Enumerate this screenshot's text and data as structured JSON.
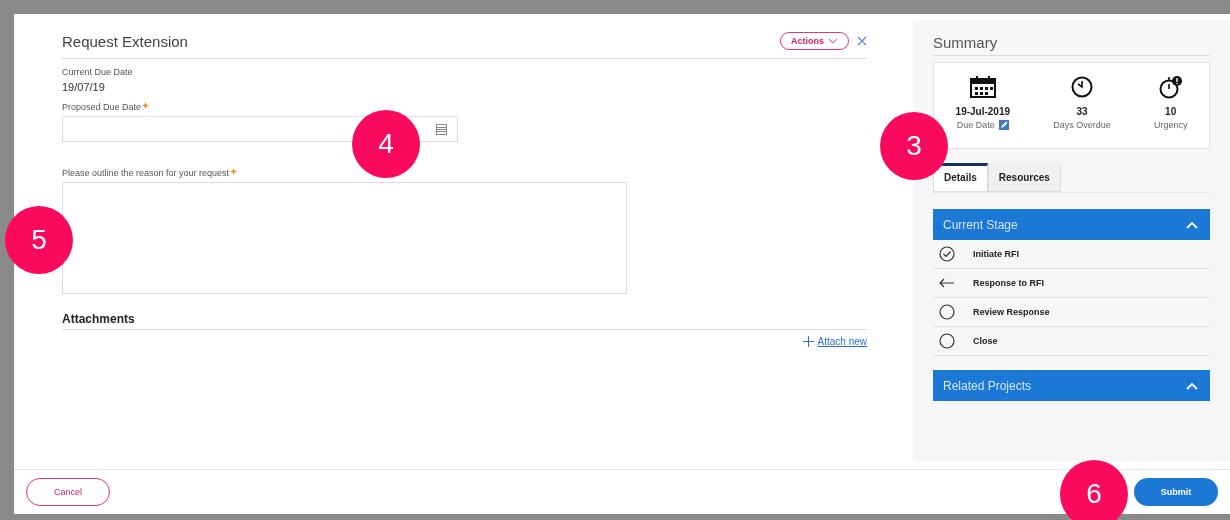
{
  "dialog": {
    "title": "Request Extension",
    "actions_button": "Actions",
    "current_due_date": {
      "label": "Current Due Date",
      "value": "19/07/19"
    },
    "proposed_due_date": {
      "label": "Proposed Due Date",
      "required": true
    },
    "reason": {
      "label": "Please outline the reason for your request",
      "required": true
    },
    "attachments": {
      "title": "Attachments",
      "link": "Attach new"
    }
  },
  "summary": {
    "title": "Summary",
    "stats": [
      {
        "kind": "calendar",
        "value": "19-Jul-2019",
        "label": "Due Date",
        "editable": true
      },
      {
        "kind": "clock",
        "value": "33",
        "label": "Days Overdue",
        "editable": false
      },
      {
        "kind": "timer",
        "value": "10",
        "label": "Urgency",
        "editable": false
      }
    ],
    "tabs": [
      {
        "label": "Details",
        "selected": true
      },
      {
        "label": "Resources",
        "selected": false
      }
    ],
    "panels": [
      {
        "title": "Current Stage",
        "expanded": true,
        "stages": [
          {
            "kind": "done",
            "label": "Initiate RFI"
          },
          {
            "kind": "current",
            "label": "Response to RFI"
          },
          {
            "kind": "pending",
            "label": "Review Response"
          },
          {
            "kind": "pending",
            "label": "Close"
          }
        ]
      },
      {
        "title": "Related Projects",
        "expanded": true
      }
    ]
  },
  "footer": {
    "cancel": "Cancel",
    "submit": "Submit"
  },
  "callouts": [
    {
      "label": "4"
    },
    {
      "label": "3"
    },
    {
      "label": "5"
    },
    {
      "label": "6"
    }
  ]
}
